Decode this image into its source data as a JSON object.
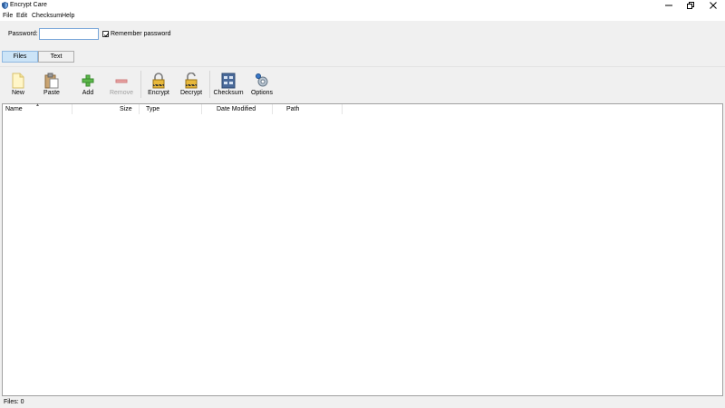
{
  "window": {
    "title": "Encrypt Care"
  },
  "menu": {
    "items": [
      "File",
      "Edit",
      "Checksum",
      "Help"
    ]
  },
  "password": {
    "label": "Password:",
    "value": "",
    "remember_label": "Remember password",
    "remember_checked": true
  },
  "tabs": [
    {
      "label": "Files",
      "active": true
    },
    {
      "label": "Text",
      "active": false
    }
  ],
  "toolbar": {
    "items": [
      {
        "label": "New",
        "icon": "new-file-icon",
        "enabled": true
      },
      {
        "label": "Paste",
        "icon": "paste-icon",
        "enabled": true
      },
      {
        "label": "Add",
        "icon": "add-icon",
        "enabled": true
      },
      {
        "label": "Remove",
        "icon": "remove-icon",
        "enabled": false
      },
      {
        "label": "Encrypt",
        "icon": "lock-icon",
        "enabled": true
      },
      {
        "label": "Decrypt",
        "icon": "unlock-icon",
        "enabled": true
      },
      {
        "label": "Checksum",
        "icon": "checksum-icon",
        "enabled": true
      },
      {
        "label": "Options",
        "icon": "options-icon",
        "enabled": true
      }
    ]
  },
  "file_list": {
    "columns": [
      "Name",
      "Size",
      "Type",
      "Date Modified",
      "Path"
    ],
    "rows": []
  },
  "status": {
    "text": "Files: 0"
  }
}
